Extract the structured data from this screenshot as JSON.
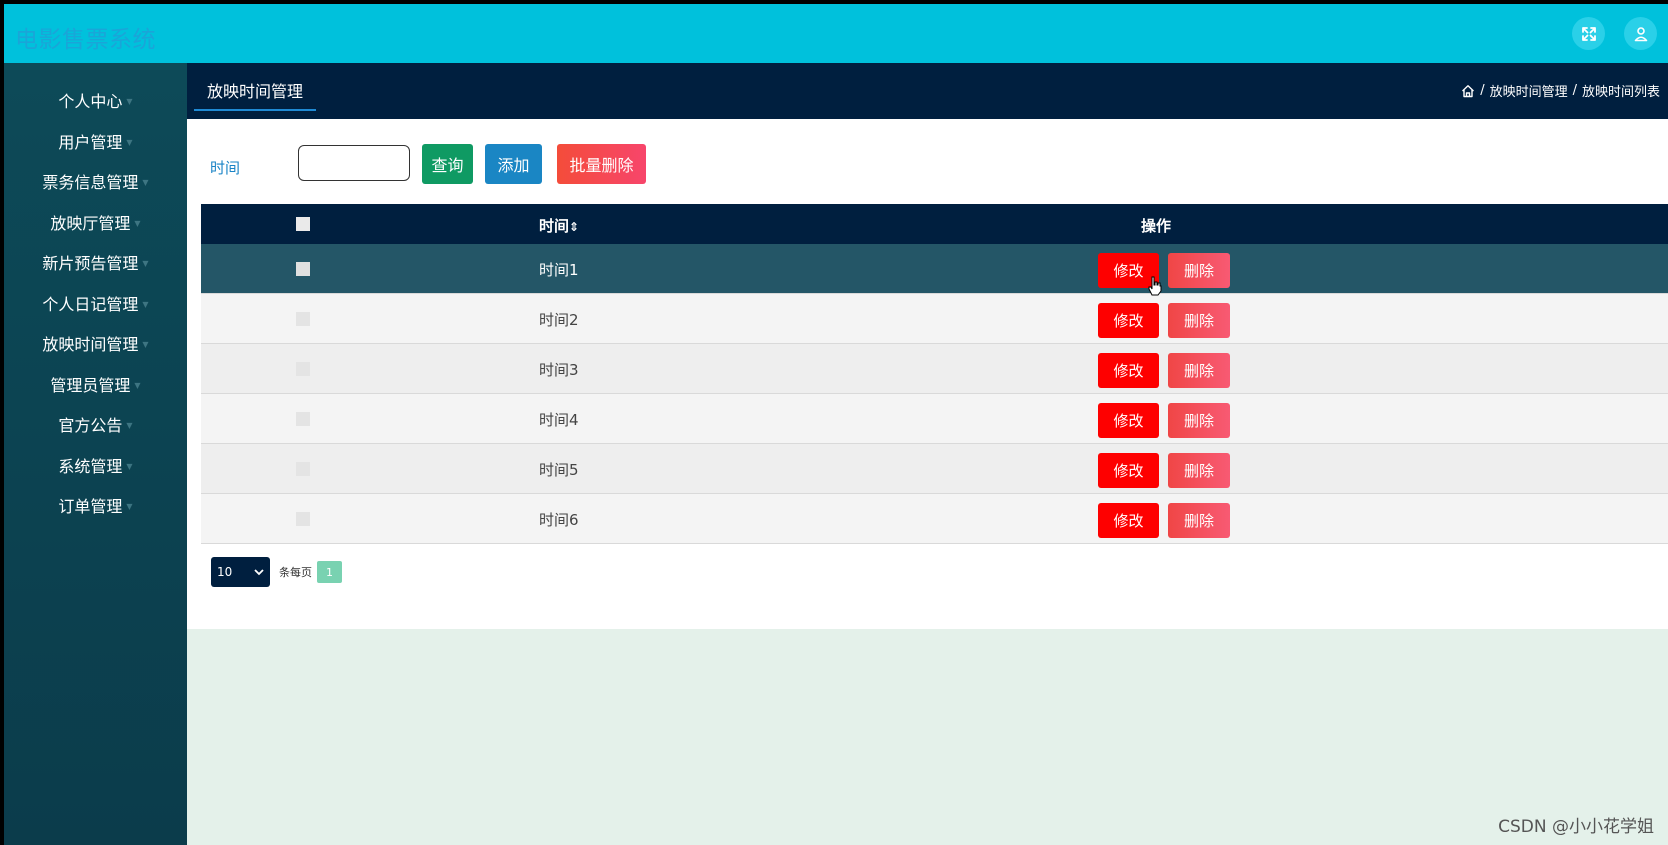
{
  "header": {
    "title": "电影售票系统"
  },
  "sidebar": {
    "items": [
      {
        "label": "个人中心"
      },
      {
        "label": "用户管理"
      },
      {
        "label": "票务信息管理"
      },
      {
        "label": "放映厅管理"
      },
      {
        "label": "新片预告管理"
      },
      {
        "label": "个人日记管理"
      },
      {
        "label": "放映时间管理"
      },
      {
        "label": "管理员管理"
      },
      {
        "label": "官方公告"
      },
      {
        "label": "系统管理"
      },
      {
        "label": "订单管理"
      }
    ]
  },
  "tabs": {
    "active": "放映时间管理"
  },
  "breadcrumb": {
    "level1": "放映时间管理",
    "level2": "放映时间列表",
    "separator": "/"
  },
  "search": {
    "label": "时间",
    "value": "",
    "placeholder": ""
  },
  "toolbar": {
    "query": "查询",
    "add": "添加",
    "batch_delete": "批量删除"
  },
  "table": {
    "headers": {
      "time": "时间",
      "sort_icon": "⇕",
      "actions": "操作"
    },
    "rows": [
      {
        "time": "时间1",
        "edit": "修改",
        "delete": "删除"
      },
      {
        "time": "时间2",
        "edit": "修改",
        "delete": "删除"
      },
      {
        "time": "时间3",
        "edit": "修改",
        "delete": "删除"
      },
      {
        "time": "时间4",
        "edit": "修改",
        "delete": "删除"
      },
      {
        "time": "时间5",
        "edit": "修改",
        "delete": "删除"
      },
      {
        "time": "时间6",
        "edit": "修改",
        "delete": "删除"
      }
    ]
  },
  "pagination": {
    "page_size": "10",
    "per_page_label": "条每页",
    "current_page": "1"
  },
  "watermark": "CSDN @小小花学姐",
  "colors": {
    "header": "#00c1dc",
    "sidebar": "#0d4a58",
    "navy": "#001f3f",
    "edit": "#fe0000"
  }
}
